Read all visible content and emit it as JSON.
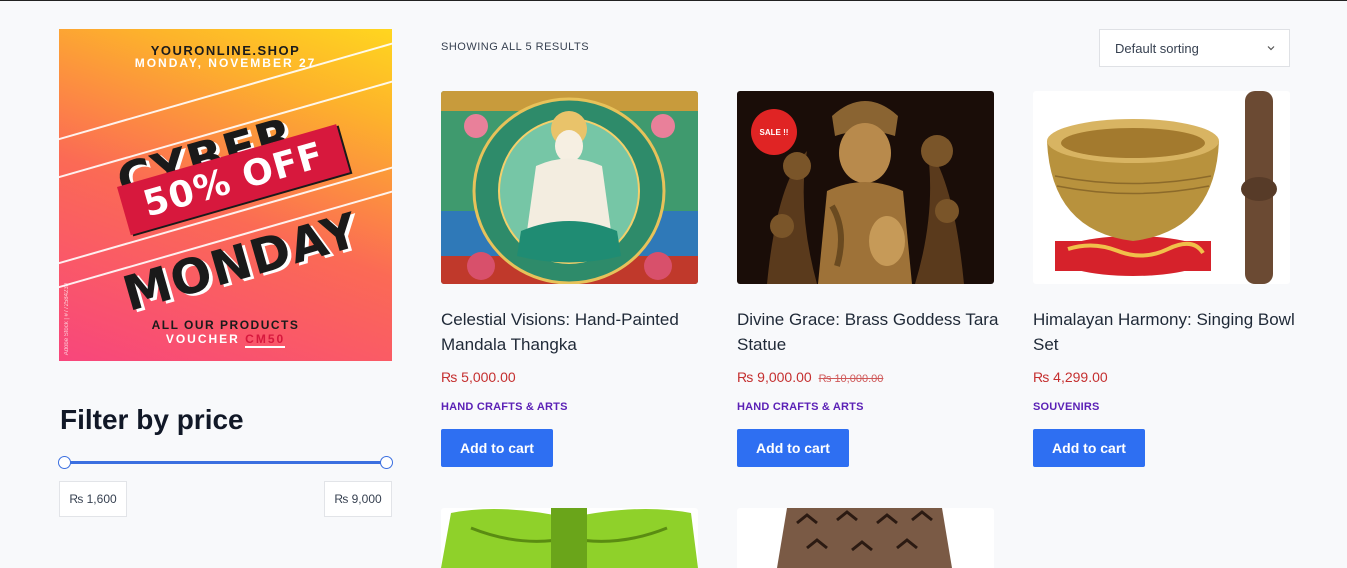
{
  "sidebar": {
    "promo": {
      "site": "YOURONLINE.SHOP",
      "date": "MONDAY, NOVEMBER 27",
      "line1": "CYBER",
      "discount": "50% OFF",
      "line2": "MONDAY",
      "footer1": "ALL OUR PRODUCTS",
      "footer2_prefix": "VOUCHER",
      "voucher_code": "CM50",
      "credit": "Adobe Stock | #772584239"
    },
    "filter": {
      "title": "Filter by price",
      "min_label": "₨ 1,600",
      "max_label": "₨ 9,000",
      "selected_min_fraction": 0.0,
      "selected_max_fraction": 1.0
    }
  },
  "toolbar": {
    "result_count": "Showing all 5 results",
    "sorting": "Default sorting"
  },
  "products": [
    {
      "title": "Celestial Visions: Hand-Painted Mandala Thangka",
      "price": "₨ 5,000.00",
      "old_price": "",
      "category": "HAND CRAFTS & ARTS",
      "button": "Add to cart",
      "sale": ""
    },
    {
      "title": "Divine Grace: Brass Goddess Tara Statue",
      "price": "₨ 9,000.00",
      "old_price": "₨ 10,000.00",
      "category": "HAND CRAFTS & ARTS",
      "button": "Add to cart",
      "sale": "SALE !!"
    },
    {
      "title": "Himalayan Harmony: Singing Bowl Set",
      "price": "₨ 4,299.00",
      "old_price": "",
      "category": "SOUVENIRS",
      "button": "Add to cart",
      "sale": ""
    }
  ],
  "colors": {
    "accent": "#2e6ff2",
    "price": "#c53030",
    "category": "#5b21b6",
    "sale": "#e02424"
  }
}
